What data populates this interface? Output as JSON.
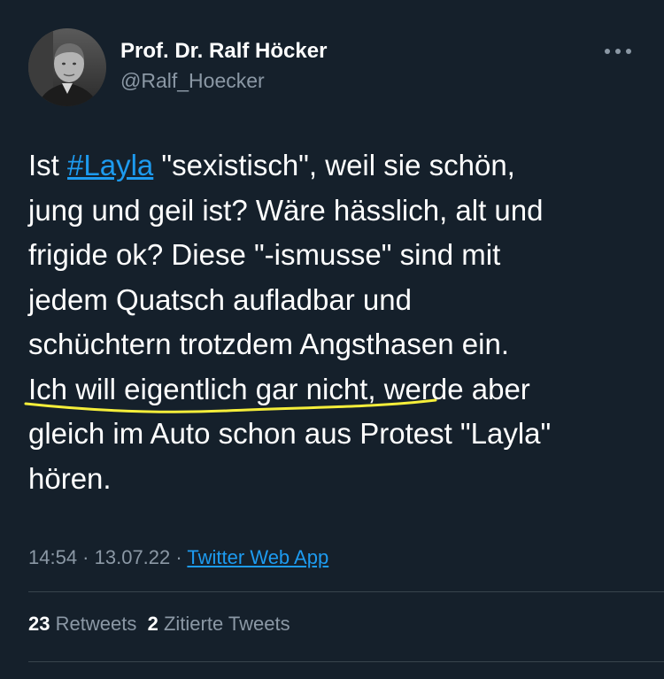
{
  "author": {
    "name": "Prof. Dr. Ralf Höcker",
    "handle": "@Ralf_Hoecker"
  },
  "tweet": {
    "lines": [
      {
        "pre": "Ist ",
        "hashtag": "#Layla",
        "post": " \"sexistisch\", weil sie schön,"
      },
      {
        "text": "jung und geil ist? Wäre hässlich, alt und"
      },
      {
        "text": "frigide ok? Diese \"-ismusse\" sind mit"
      },
      {
        "text": "jedem Quatsch aufladbar und"
      },
      {
        "text": "schüchtern trotzdem Angsthasen ein."
      },
      {
        "text": "Ich will eigentlich gar nicht, werde aber"
      },
      {
        "text": "gleich im Auto schon aus Protest \"Layla\""
      },
      {
        "text": "hören."
      }
    ],
    "time": "14:54",
    "separator": " · ",
    "date": "13.07.22",
    "source": "Twitter Web App"
  },
  "stats": {
    "retweets_count": "23",
    "retweets_label": "Retweets",
    "quotes_count": "2",
    "quotes_label": "Zitierte Tweets"
  },
  "colors": {
    "background": "#15202b",
    "link": "#1d9bf0",
    "secondary_text": "#8b98a5",
    "highlight_underline": "#f5ee3a"
  },
  "icons": {
    "more": "more-horizontal-icon"
  }
}
